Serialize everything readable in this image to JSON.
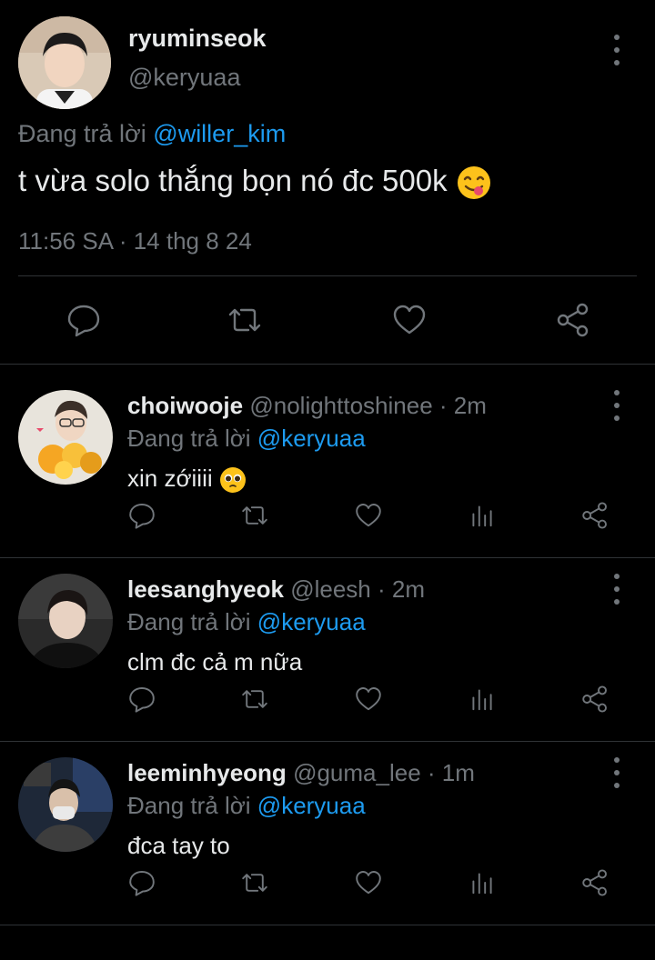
{
  "main_tweet": {
    "display_name": "ryuminseok",
    "handle": "@keryuaa",
    "replying_prefix": "Đang trả lời",
    "replying_to": "@willer_kim",
    "text": "t vừa solo thắng bọn nó đc 500k",
    "emoji": "face-savoring-food",
    "timestamp": "11:56 SA · 14 thg 8 24",
    "actions": [
      "reply-icon",
      "retweet-icon",
      "like-icon",
      "share-icon"
    ]
  },
  "replies": [
    {
      "display_name": "choiwooje",
      "handle": "@nolighttoshinee",
      "time": "· 2m",
      "replying_prefix": "Đang trả lời",
      "replying_to": "@keryuaa",
      "text": "xin zớiiii",
      "emoji": "pleading-face"
    },
    {
      "display_name": "leesanghyeok",
      "handle": "@leesh",
      "time": "· 2m",
      "replying_prefix": "Đang trả lời",
      "replying_to": "@keryuaa",
      "text": "clm đc cả m nữa"
    },
    {
      "display_name": "leeminhyeong",
      "handle": "@guma_lee",
      "time": "· 1m",
      "replying_prefix": "Đang trả lời",
      "replying_to": "@keryuaa",
      "text": "đca tay to"
    }
  ],
  "reply_actions": [
    "reply-icon",
    "retweet-icon",
    "like-icon",
    "views-icon",
    "share-icon"
  ],
  "colors": {
    "background": "#000000",
    "text": "#e7e9ea",
    "muted": "#71767b",
    "link": "#1d9bf0",
    "divider": "#2f3336"
  }
}
